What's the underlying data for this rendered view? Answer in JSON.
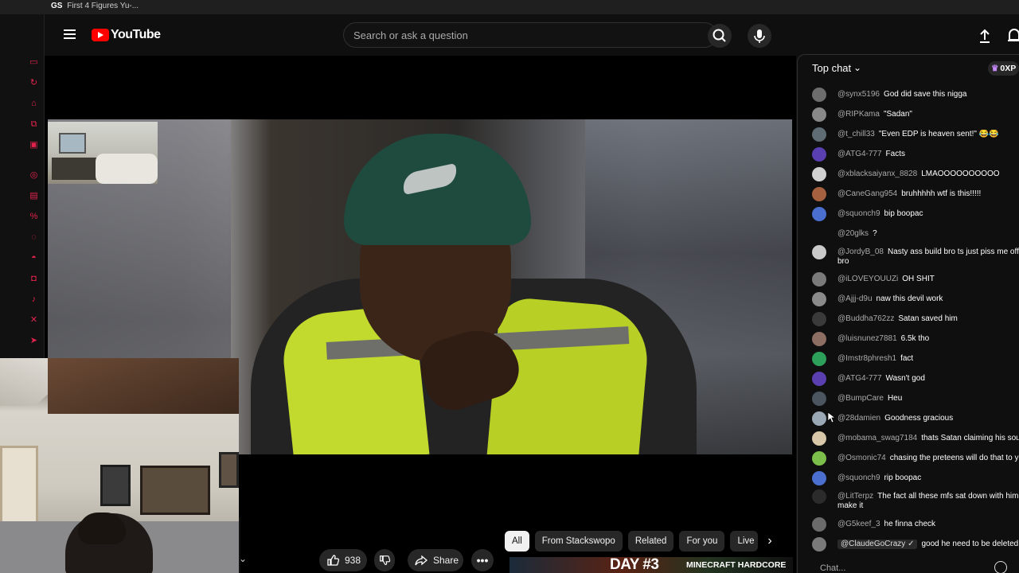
{
  "browser_tab": {
    "prefix": "GS",
    "title": "First 4 Figures Yu-..."
  },
  "header": {
    "logo_text": "YouTube",
    "search_placeholder": "Search or ask a question",
    "icons": [
      "menu-icon",
      "search-icon",
      "mic-icon",
      "upload-icon",
      "bell-icon"
    ]
  },
  "sidebar_icons": [
    "video-icon",
    "refresh-icon",
    "hat-icon",
    "link-icon",
    "card-icon",
    "target-icon",
    "twitch-icon",
    "percent-icon",
    "whatsapp-icon",
    "discord-icon",
    "instagram-icon",
    "tiktok-icon",
    "x-icon",
    "telegram-icon"
  ],
  "actions": {
    "like_count": "938",
    "share_label": "Share",
    "more_label": "•••"
  },
  "chips": [
    {
      "label": "All",
      "active": true
    },
    {
      "label": "From Stackswopo",
      "active": false
    },
    {
      "label": "Related",
      "active": false
    },
    {
      "label": "For you",
      "active": false
    },
    {
      "label": "Live",
      "active": false
    }
  ],
  "recommendation": {
    "title": "DAY #3",
    "subtitle": "MINECRAFT HARDCORE"
  },
  "chat": {
    "filter_label": "Top chat",
    "xp_label": "0XP",
    "input_placeholder": "Chat...",
    "messages": [
      {
        "author": "@synx5196",
        "text": "God did save this nigga",
        "avatar_color": "#6d6d6d"
      },
      {
        "author": "@RIPKama",
        "text": "\"Sadan\"",
        "avatar_color": "#888888"
      },
      {
        "author": "@t_chill33",
        "text": "\"Even EDP is heaven sent!\" 😂😂",
        "avatar_color": "#5f6c74"
      },
      {
        "author": "@ATG4-777",
        "text": "Facts",
        "avatar_color": "#5a3fb0"
      },
      {
        "author": "@xblacksaiyanx_8828",
        "text": "LMAOOOOOOOOOO",
        "avatar_color": "#d0d0d0"
      },
      {
        "author": "@CaneGang954",
        "text": "bruhhhhh wtf is this!!!!!",
        "avatar_color": "#a5613f"
      },
      {
        "author": "@squonch9",
        "text": "bip boopac",
        "avatar_color": "#4b6fcf"
      },
      {
        "author": "@20glks",
        "text": "?",
        "avatar_color": "#0f0f0f"
      },
      {
        "author": "@JordyB_08",
        "text": "Nasty ass build bro ts just piss me off at bro",
        "avatar_color": "#c9c9c9"
      },
      {
        "author": "@iLOVEYOUUZi",
        "text": "OH SHIT",
        "avatar_color": "#7a7a7a"
      },
      {
        "author": "@Ajjj-d9u",
        "text": "naw this devil work",
        "avatar_color": "#8a8a8a"
      },
      {
        "author": "@Buddha762zz",
        "text": "Satan saved him",
        "avatar_color": "#3a3a3a"
      },
      {
        "author": "@luisnunez7881",
        "text": "6.5k tho",
        "avatar_color": "#8d6e63"
      },
      {
        "author": "@Imstr8phresh1",
        "text": "fact",
        "avatar_color": "#2e9e5b"
      },
      {
        "author": "@ATG4-777",
        "text": "Wasn't god",
        "avatar_color": "#5a3fb0"
      },
      {
        "author": "@BumpCare",
        "text": "Heu",
        "avatar_color": "#4a5560"
      },
      {
        "author": "@28damien",
        "text": "Goodness gracious",
        "avatar_color": "#9aa7b4"
      },
      {
        "author": "@mobama_swag7184",
        "text": "thats Satan claiming his soul",
        "avatar_color": "#d8c7a8"
      },
      {
        "author": "@Osmonic74",
        "text": "chasing the preteens will do that to you",
        "avatar_color": "#7bbf4a"
      },
      {
        "author": "@squonch9",
        "text": "rip boopac",
        "avatar_color": "#4b6fcf"
      },
      {
        "author": "@LitTerpz",
        "text": "The fact all these mfs sat down with him to make it",
        "avatar_color": "#2b2b2b"
      },
      {
        "author": "@G5keef_3",
        "text": "he finna check",
        "avatar_color": "#6b6b6b"
      },
      {
        "author": "@ClaudeGoCrazy ✓",
        "text": "good he need to be deleted",
        "avatar_color": "#7a7a7a",
        "badge": true
      }
    ]
  }
}
